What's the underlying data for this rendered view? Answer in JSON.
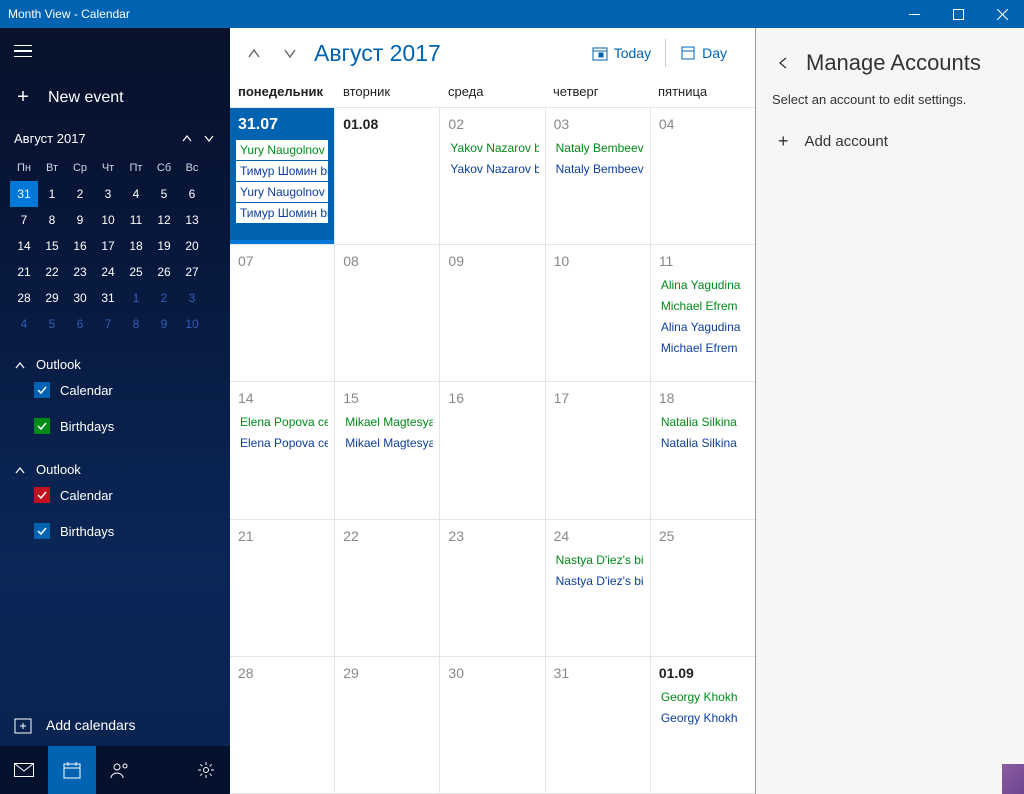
{
  "window": {
    "title": "Month View - Calendar"
  },
  "sidebar": {
    "newEvent": "New event",
    "miniHeader": "Август 2017",
    "weekdays": [
      "Пн",
      "Вт",
      "Ср",
      "Чт",
      "Пт",
      "Сб",
      "Вс"
    ],
    "miniGrid": [
      [
        {
          "n": "31",
          "sel": true
        },
        {
          "n": "1"
        },
        {
          "n": "2"
        },
        {
          "n": "3"
        },
        {
          "n": "4"
        },
        {
          "n": "5"
        },
        {
          "n": "6"
        }
      ],
      [
        {
          "n": "7"
        },
        {
          "n": "8"
        },
        {
          "n": "9"
        },
        {
          "n": "10"
        },
        {
          "n": "11"
        },
        {
          "n": "12"
        },
        {
          "n": "13"
        }
      ],
      [
        {
          "n": "14"
        },
        {
          "n": "15"
        },
        {
          "n": "16"
        },
        {
          "n": "17"
        },
        {
          "n": "18"
        },
        {
          "n": "19"
        },
        {
          "n": "20"
        }
      ],
      [
        {
          "n": "21"
        },
        {
          "n": "22"
        },
        {
          "n": "23"
        },
        {
          "n": "24"
        },
        {
          "n": "25"
        },
        {
          "n": "26"
        },
        {
          "n": "27"
        }
      ],
      [
        {
          "n": "28"
        },
        {
          "n": "29"
        },
        {
          "n": "30"
        },
        {
          "n": "31"
        },
        {
          "n": "1",
          "other": true
        },
        {
          "n": "2",
          "other": true
        },
        {
          "n": "3",
          "other": true
        }
      ],
      [
        {
          "n": "4",
          "other": true
        },
        {
          "n": "5",
          "other": true
        },
        {
          "n": "6",
          "other": true
        },
        {
          "n": "7",
          "other": true
        },
        {
          "n": "8",
          "other": true
        },
        {
          "n": "9",
          "other": true
        },
        {
          "n": "10",
          "other": true
        }
      ]
    ],
    "accounts": [
      {
        "name": "Outlook",
        "cals": [
          {
            "label": "Calendar",
            "color": "blue"
          },
          {
            "label": "Birthdays",
            "color": "green"
          }
        ]
      },
      {
        "name": "Outlook",
        "cals": [
          {
            "label": "Calendar",
            "color": "red"
          },
          {
            "label": "Birthdays",
            "color": "blue"
          }
        ]
      }
    ],
    "addCalendars": "Add calendars"
  },
  "calendar": {
    "title": "Август 2017",
    "todayBtn": "Today",
    "dayBtn": "Day",
    "weekdays": [
      "понедельник",
      "вторник",
      "среда",
      "четверг",
      "пятница"
    ],
    "weeks": [
      [
        {
          "num": "31.07",
          "today": true,
          "events": [
            {
              "t": "Yury Naugolnov bi",
              "k": "bd"
            },
            {
              "t": "Тимур Шомин birt",
              "k": "cal"
            },
            {
              "t": "Yury Naugolnov bi",
              "k": "cal"
            },
            {
              "t": "Тимур Шомин birt",
              "k": "cal"
            }
          ]
        },
        {
          "num": "01.08",
          "bold": true,
          "events": []
        },
        {
          "num": "02",
          "events": [
            {
              "t": "Yakov Nazarov birt",
              "k": "bd"
            },
            {
              "t": "Yakov Nazarov birt",
              "k": "cal"
            }
          ]
        },
        {
          "num": "03",
          "events": [
            {
              "t": "Nataly Bembeeva l",
              "k": "bd"
            },
            {
              "t": "Nataly Bembeeva l",
              "k": "cal"
            }
          ]
        },
        {
          "num": "04",
          "events": []
        }
      ],
      [
        {
          "num": "07",
          "events": []
        },
        {
          "num": "08",
          "events": []
        },
        {
          "num": "09",
          "events": []
        },
        {
          "num": "10",
          "events": []
        },
        {
          "num": "11",
          "events": [
            {
              "t": "Alina Yagudina",
              "k": "bd"
            },
            {
              "t": "Michael Efrem",
              "k": "bd"
            },
            {
              "t": "Alina Yagudina",
              "k": "cal"
            },
            {
              "t": "Michael Efrem",
              "k": "cal"
            }
          ]
        }
      ],
      [
        {
          "num": "14",
          "events": [
            {
              "t": "Elena Popova cell:-",
              "k": "bd"
            },
            {
              "t": "Elena Popova cell:-",
              "k": "cal"
            }
          ]
        },
        {
          "num": "15",
          "events": [
            {
              "t": "Mikael Magtesyan",
              "k": "bd"
            },
            {
              "t": "Mikael Magtesyan",
              "k": "cal"
            }
          ]
        },
        {
          "num": "16",
          "events": []
        },
        {
          "num": "17",
          "events": []
        },
        {
          "num": "18",
          "events": [
            {
              "t": "Natalia Silkina",
              "k": "bd"
            },
            {
              "t": "Natalia Silkina",
              "k": "cal"
            }
          ]
        }
      ],
      [
        {
          "num": "21",
          "events": []
        },
        {
          "num": "22",
          "events": []
        },
        {
          "num": "23",
          "events": []
        },
        {
          "num": "24",
          "events": [
            {
              "t": "Nastya D'iez's birth",
              "k": "bd"
            },
            {
              "t": "Nastya D'iez's birth",
              "k": "cal"
            }
          ]
        },
        {
          "num": "25",
          "events": []
        }
      ],
      [
        {
          "num": "28",
          "events": []
        },
        {
          "num": "29",
          "events": []
        },
        {
          "num": "30",
          "events": []
        },
        {
          "num": "31",
          "events": []
        },
        {
          "num": "01.09",
          "bold": true,
          "events": [
            {
              "t": "Georgy Khokh",
              "k": "bd"
            },
            {
              "t": "Georgy Khokh",
              "k": "cal"
            }
          ]
        }
      ]
    ]
  },
  "panel": {
    "title": "Manage Accounts",
    "instruction": "Select an account to edit settings.",
    "addAccount": "Add account"
  }
}
